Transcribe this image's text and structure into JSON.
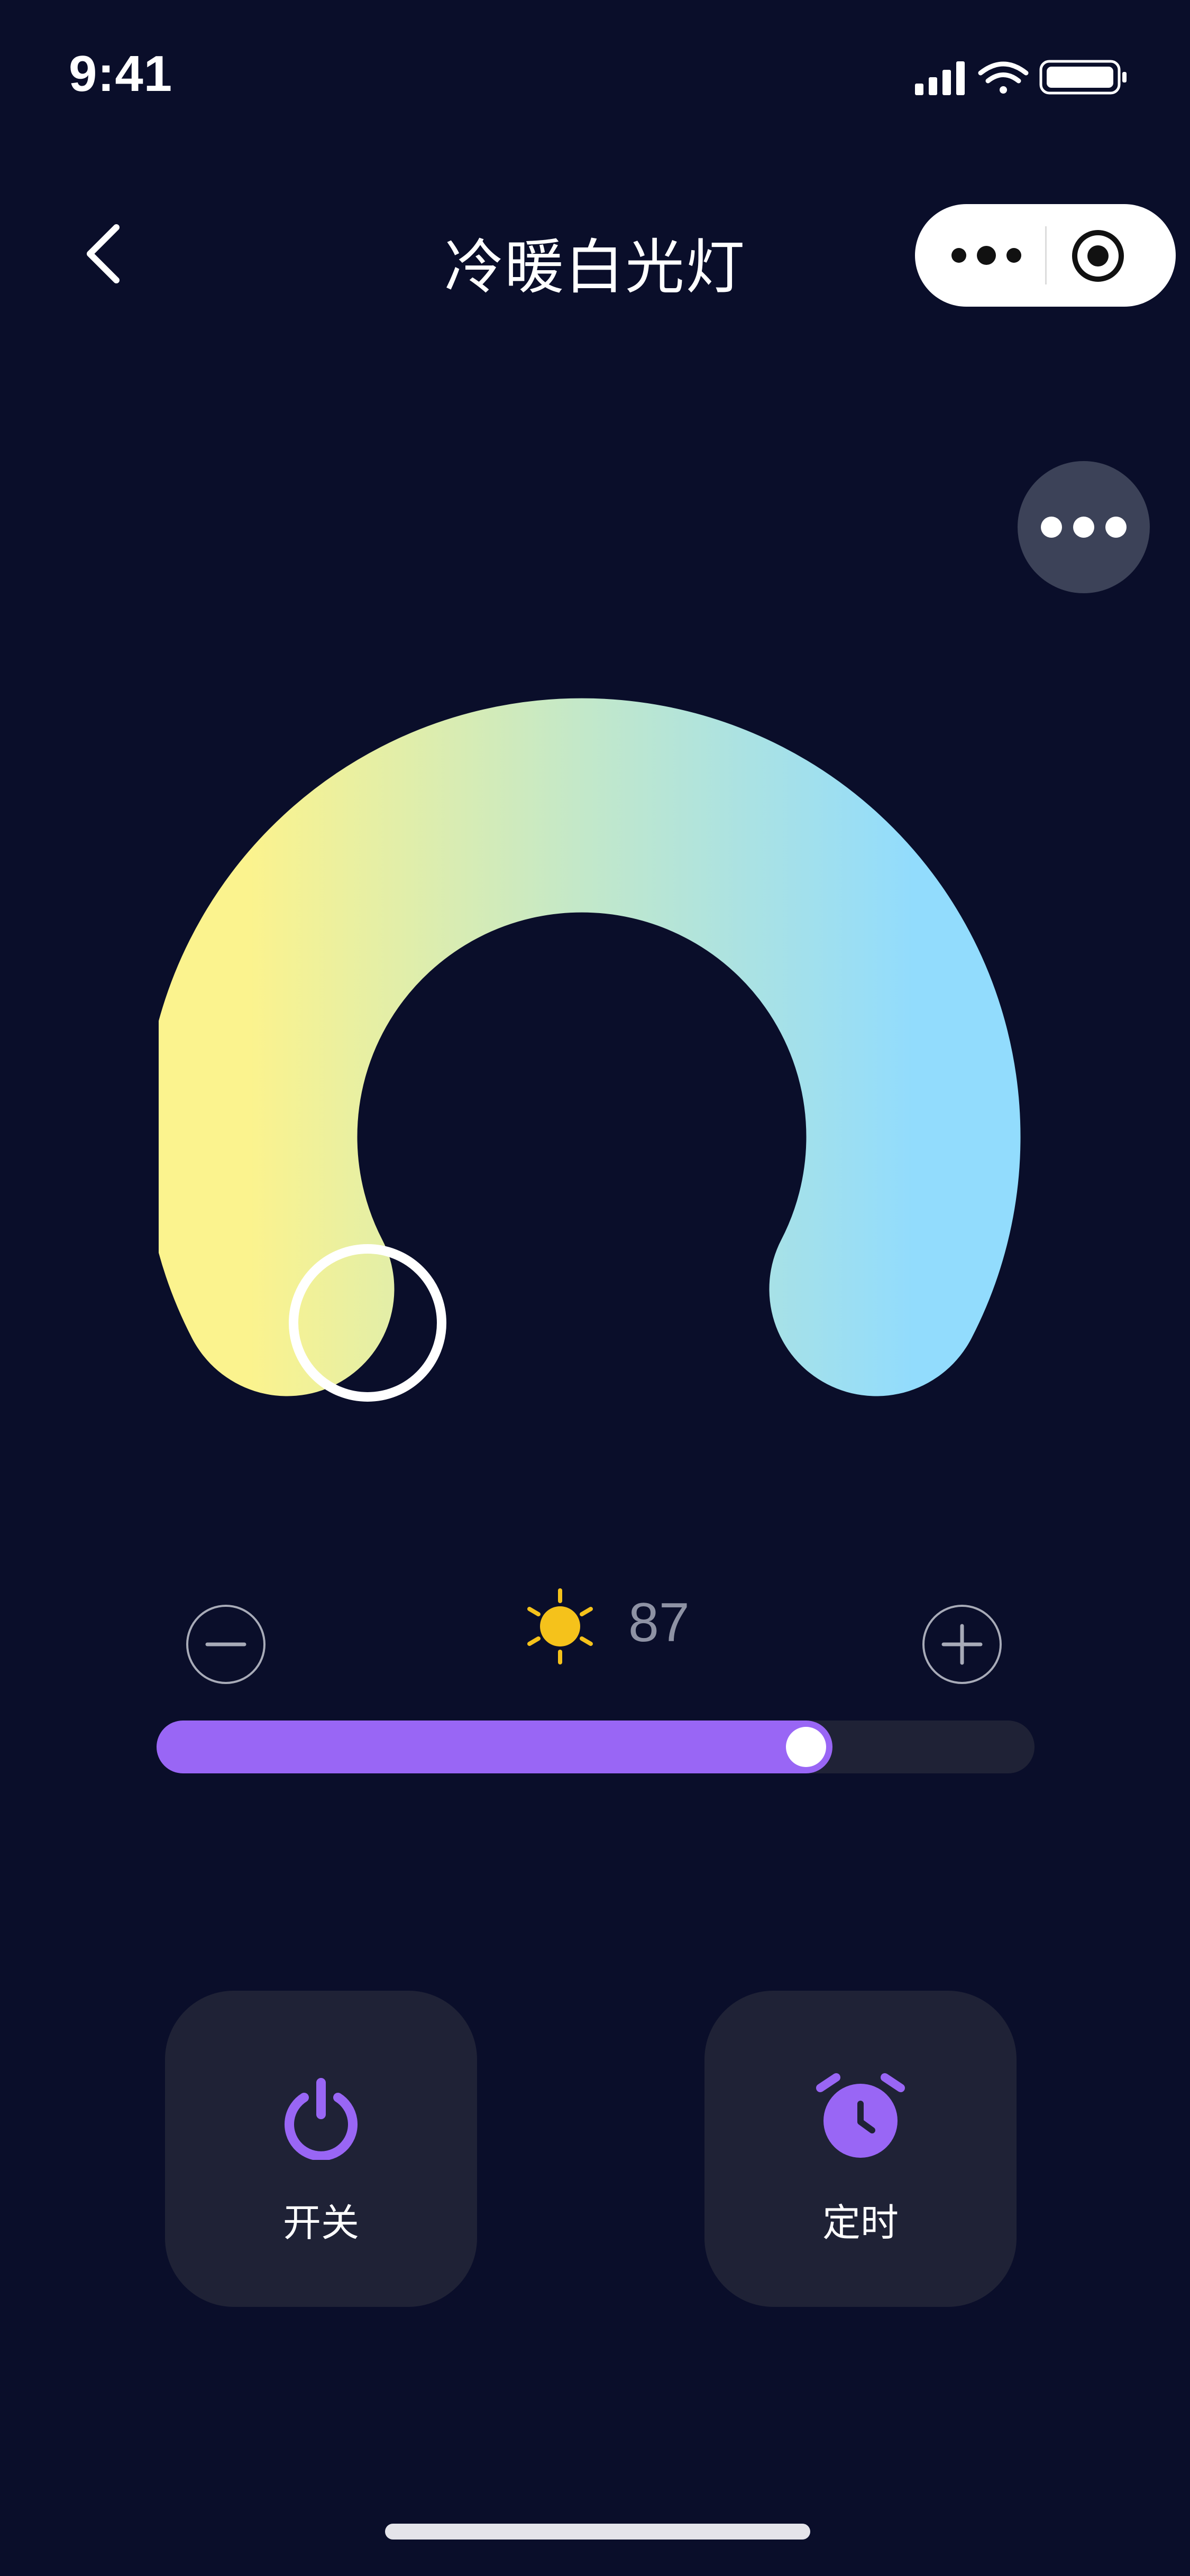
{
  "status_bar": {
    "time": "9:41",
    "icons": [
      "cellular-signal-icon",
      "wifi-icon",
      "battery-icon"
    ]
  },
  "nav": {
    "title": "冷暖白光灯",
    "back_icon": "chevron-left-icon",
    "capsule": {
      "menu_icon": "ellipsis-icon",
      "close_icon": "target-icon"
    }
  },
  "more_button": {
    "icon": "ellipsis-icon"
  },
  "color_ring": {
    "warm_color": "#fbf38e",
    "cool_color": "#92dcfd",
    "selected_position": 0.1
  },
  "brightness": {
    "value": "87",
    "sun_icon": "sun-icon",
    "decrease_icon": "minus-circle-icon",
    "increase_icon": "plus-circle-icon",
    "slider_level_percent": 77,
    "fill_color": "#9966f5"
  },
  "actions": [
    {
      "label": "开关",
      "icon": "power-icon"
    },
    {
      "label": "定时",
      "icon": "alarm-clock-icon"
    }
  ],
  "colors": {
    "background": "#0a0e2a",
    "card": "#1f2236",
    "accent": "#9966f5",
    "sun": "#f5c21b"
  }
}
